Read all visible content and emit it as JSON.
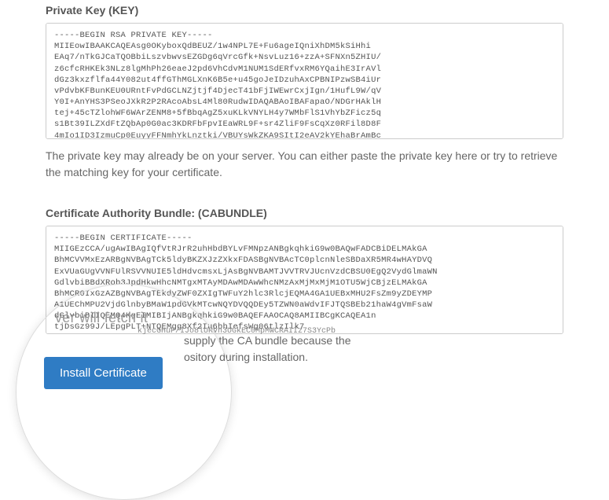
{
  "labels": {
    "private_key": "Private Key (KEY)",
    "cabundle": "Certificate Authority Bundle: (CABUNDLE)"
  },
  "private_key": {
    "content": "-----BEGIN RSA PRIVATE KEY-----\nMIIEowIBAAKCAQEAsg0OKyboxQdBEUZ/1w4NPL7E+Fu6ageIQniXhDM5kSiHhi\nEAq7/nTkGJCaTQOBbiLszvbwvsEZGDg6qVrcGfk+NsvLuz16+zzA+SFNXn5ZHIU/\nz6cfcRHKEk3NLz8lgMhPh26eaeJ2pd6VhCdvM1NUM1SdERfvxRM6YQaihE3IrAVl\ndGz3kxzflfa44Y082ut4ffGThMGLXnK6B5e+u45goJeIDzuhAxCPBNIPzwSB4iUr\nvPdvbKFBunKEU0URntFvPdGCLNZjtjf4DjecT41bFjIWEwrCxjIgn/1HufL9W/qV\nY0I+AnYHS3PSeoJXkR2P2RAcoAbsL4Ml80RudwIDAQABAoIBAFapaO/NDGrHAklH\ntej+45cTZlohWF6WArZENM8+5fBbqAgZ5xuKLkVNYLH4y7WMbFlS1VhYbZFicz5q\ns1Bt39ILZXdFtZQbAp0G0ac3KDRFbFpvIEaWRL9F+sr4ZliF9FsCqXz0RFil8D8F\n4mIo1ID3IzmuCp0EuyyFFNmhYkLnztki/VBUYsWkZKA9SItI2eAV2kYEhaBrAmBc\n"
  },
  "private_key_help": "The private key may already be on your server. You can either paste the private key here or try to retrieve the matching key for your certificate.",
  "cabundle": {
    "content": "-----BEGIN CERTIFICATE-----\nMIIGEzCCA/ugAwIBAgIQfVtRJrR2uhHbdBYLvFMNpzANBgkqhkiG9w0BAQwFADCBiDELMAkGA\nBhMCVVMxEzARBgNVBAgTCk5ldyBKZXJzZXkxFDASBgNVBAcTC0plcnNleSBDaXR5MR4wHAYDVQ\nExVUaGUgVVNFUlRSVVNUIE5ldHdvcmsxLjAsBgNVBAMTJVVTRVJUcnVzdCBSU0EgQ2VydGlmaWN\nGdlvbiBBdXRob3JpdHkwHhcNMTgxMTAyMDAwMDAwWhcNMzAxMjMxMjM1OTU5WjCBjzELMAkGA\nBhMCR0IxGzAZBgNVBAgTEkdyZWF0ZXIgTWFuY2hlc3RlcjEQMA4GA1UEBxMHU2FsZm9yZDEYMP\nA1UEChMPU2VjdGlnbyBMaW1pdGVkMTcwNQYDVQQDEy5TZWN0aWdvIFJTQSBEb21haW4gVmFsaW\ndGlvbiBIIQEMQ4KgEIMIBIjANBgkqhkiG9w0BAQEFAAOCAQ8AMIIBCgKCAQEA1n\ntjDsGz99J/LEpgPLT+NTQEMgg8Xf2Iu6bhIefsWg06tlzIlk7\nkjecGHuP/IJo8lURvh3UGkEC0MpMWCRAIIz7S3YcPb\n"
  },
  "lens_text": {
    "fetch_line": "ver will fetch it",
    "fetch_sub": "kjecGHuP/IJo8lURvh3UGkEC0MpMWCRAIIz7S3YcPb"
  },
  "cabundle_help": {
    "l1": "supply the CA bundle because the",
    "l2": "ository during installation."
  },
  "buttons": {
    "install": "Install Certificate"
  }
}
